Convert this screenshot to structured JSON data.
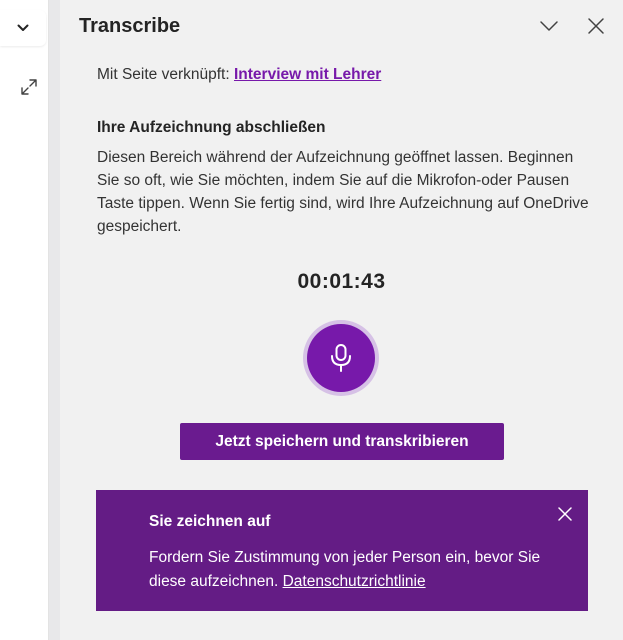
{
  "colors": {
    "accent": "#7719aa",
    "save_button": "#6a1b8f",
    "banner_bg": "#641c85",
    "pane_bg": "#f1f1f1"
  },
  "left_panel": {
    "dropdown_icon": "chevron-down-icon",
    "expand_icon": "expand-diagonal-icon"
  },
  "pane": {
    "title": "Transcribe",
    "collapse_icon": "chevron-down-icon",
    "close_icon": "close-icon"
  },
  "linked_page": {
    "prefix": "Mit Seite verknüpft:",
    "link_text": "Interview mit Lehrer"
  },
  "recording": {
    "heading": "Ihre Aufzeichnung abschließen",
    "description": "Diesen Bereich während der Aufzeichnung geöffnet lassen. Beginnen Sie so oft, wie Sie möchten, indem Sie auf die Mikrofon-oder Pausen Taste tippen. Wenn Sie fertig sind, wird Ihre Aufzeichnung auf OneDrive gespeichert.",
    "timer": "00:01:43",
    "mic_icon": "microphone-icon",
    "save_label": "Jetzt speichern und transkribieren"
  },
  "banner": {
    "title": "Sie zeichnen auf",
    "text": "Fordern Sie Zustimmung von jeder Person ein, bevor Sie diese aufzeichnen.",
    "link_text": "Datenschutzrichtlinie",
    "close_icon": "close-icon"
  }
}
